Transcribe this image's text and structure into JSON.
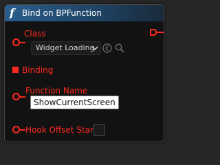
{
  "node": {
    "title": "Bind on BPFunction",
    "icon": "function-icon",
    "header_color": "#2a5d8c",
    "pin_color": "#ff2a1f"
  },
  "pins": {
    "class": {
      "label": "Class",
      "selected_value": "Widget Loading"
    },
    "binding": {
      "label": "Binding"
    },
    "function_name": {
      "label": "Function Name",
      "value": "ShowCurrentScreen"
    },
    "hook_offset_start": {
      "label": "Hook Offset Start",
      "checked": false
    }
  },
  "icons": {
    "use_selected": "arrow-left-circle-icon",
    "browse": "magnifier-icon",
    "dropdown": "chevron-down-icon",
    "output_pin": "delegate-output-pin-icon"
  }
}
